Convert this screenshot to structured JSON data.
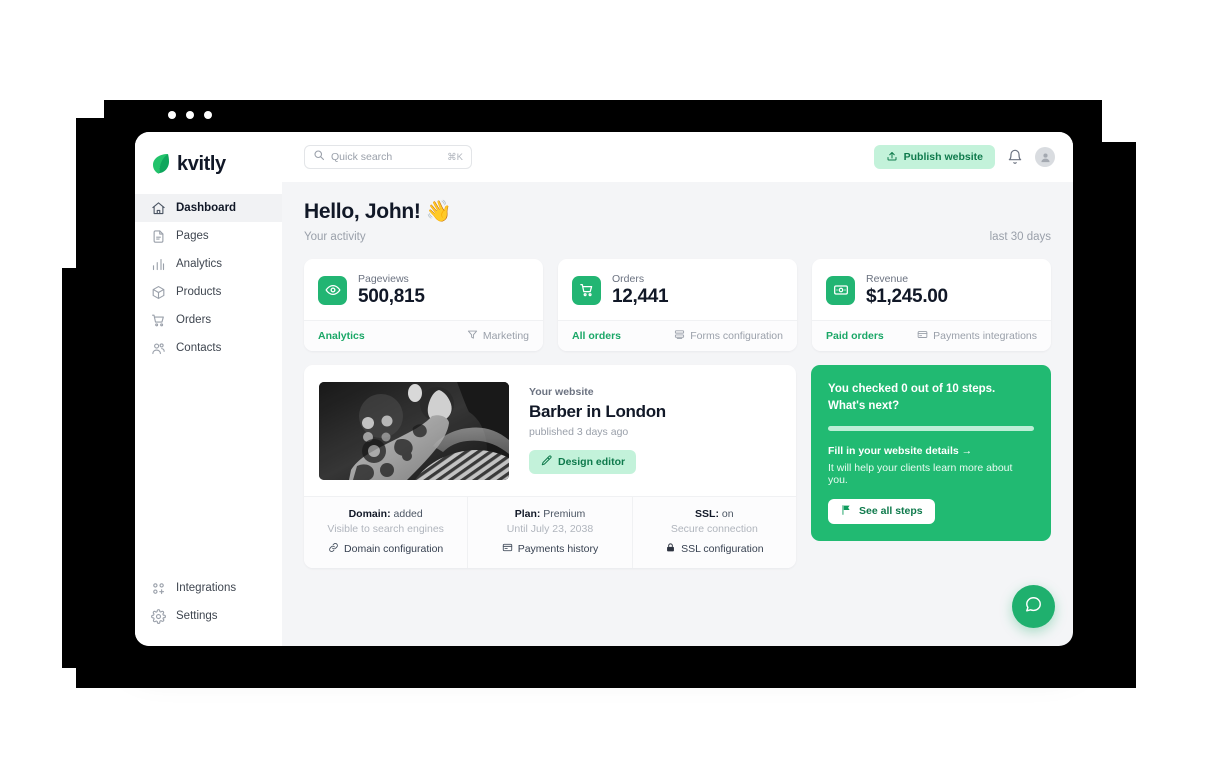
{
  "brand": {
    "name": "kvitly",
    "logo_icon": "leaf-icon",
    "accent": "#21ba72",
    "accent_light": "#c3f2da"
  },
  "window_dots": [
    "dot",
    "dot",
    "dot"
  ],
  "sidebar": {
    "items": [
      {
        "label": "Dashboard",
        "icon": "home-icon",
        "active": true
      },
      {
        "label": "Pages",
        "icon": "file-icon",
        "active": false
      },
      {
        "label": "Analytics",
        "icon": "bar-chart-icon",
        "active": false
      },
      {
        "label": "Products",
        "icon": "cube-icon",
        "active": false
      },
      {
        "label": "Orders",
        "icon": "cart-icon",
        "active": false
      },
      {
        "label": "Contacts",
        "icon": "people-icon",
        "active": false
      }
    ],
    "bottom_items": [
      {
        "label": "Integrations",
        "icon": "integrations-icon"
      },
      {
        "label": "Settings",
        "icon": "gear-icon"
      }
    ]
  },
  "topbar": {
    "search": {
      "placeholder": "Quick search",
      "value": "",
      "shortcut": "⌘K",
      "icon": "search-icon"
    },
    "publish_label": "Publish website",
    "publish_icon": "upload-icon",
    "bell_icon": "bell-icon",
    "avatar_icon": "user-avatar-icon"
  },
  "header": {
    "greeting": "Hello, John!",
    "greeting_emoji": "👋",
    "subtitle": "Your activity",
    "range": "last 30 days"
  },
  "stats": [
    {
      "label": "Pageviews",
      "value": "500,815",
      "icon": "eye-icon",
      "link": "Analytics",
      "secondary": "Marketing",
      "secondary_icon": "funnel-icon"
    },
    {
      "label": "Orders",
      "value": "12,441",
      "icon": "cart-icon",
      "link": "All orders",
      "secondary": "Forms configuration",
      "secondary_icon": "forms-icon"
    },
    {
      "label": "Revenue",
      "value": "$1,245.00",
      "icon": "money-icon",
      "link": "Paid orders",
      "secondary": "Payments integrations",
      "secondary_icon": "card-icon"
    }
  ],
  "website": {
    "kicker": "Your website",
    "title": "Barber in London",
    "published": "published 3 days ago",
    "design_button": "Design editor",
    "design_icon": "brush-icon",
    "thumbnail_alt": "barber-photo",
    "footer": [
      {
        "title_bold": "Domain:",
        "title_rest": " added",
        "sub": "Visible to search engines",
        "link": "Domain configuration",
        "icon": "link-icon"
      },
      {
        "title_bold": "Plan:",
        "title_rest": " Premium",
        "sub": "Until July 23, 2038",
        "link": "Payments history",
        "icon": "receipt-icon"
      },
      {
        "title_bold": "SSL:",
        "title_rest": " on",
        "sub": "Secure connection",
        "link": "SSL configuration",
        "icon": "lock-icon"
      }
    ]
  },
  "steps": {
    "headline_line1": "You checked 0 out of 10 steps.",
    "headline_line2": "What's next?",
    "progress_percent": 0,
    "next_step_link": "Fill in your website details →",
    "next_step_desc": "It will help your clients learn more about you.",
    "button_label": "See all steps",
    "button_icon": "flag-icon"
  },
  "help": {
    "icon": "chat-bubble-icon"
  }
}
